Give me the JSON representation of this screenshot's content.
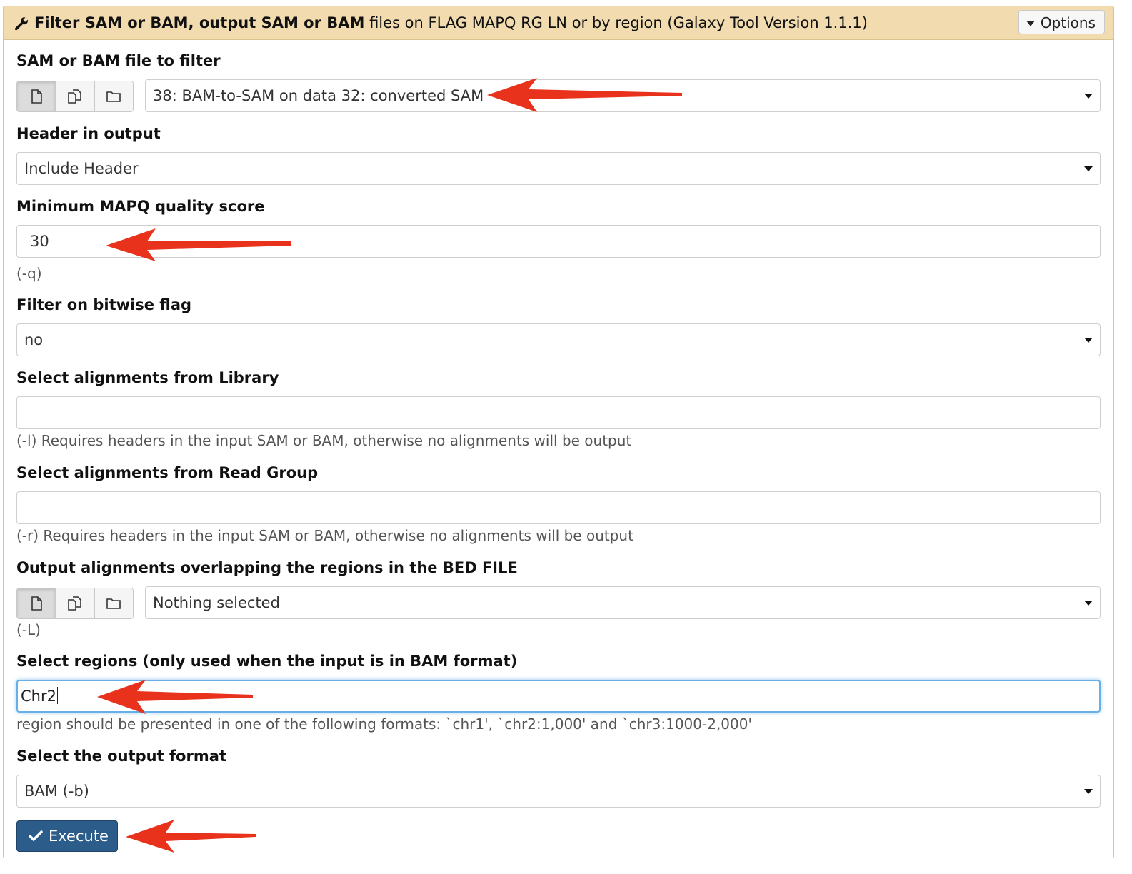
{
  "header": {
    "title_bold": "Filter SAM or BAM, output SAM or BAM",
    "title_rest": " files on FLAG MAPQ RG LN or by region (Galaxy Tool Version 1.1.1)",
    "options_label": "Options"
  },
  "fields": {
    "input_file": {
      "label": "SAM or BAM file to filter",
      "value": "38: BAM-to-SAM on data 32: converted SAM"
    },
    "header_output": {
      "label": "Header in output",
      "value": "Include Header"
    },
    "mapq": {
      "label": "Minimum MAPQ quality score",
      "value": "30",
      "help": "(-q)"
    },
    "bitwise_flag": {
      "label": "Filter on bitwise flag",
      "value": "no"
    },
    "library": {
      "label": "Select alignments from Library",
      "value": "",
      "help": "(-l) Requires headers in the input SAM or BAM, otherwise no alignments will be output"
    },
    "read_group": {
      "label": "Select alignments from Read Group",
      "value": "",
      "help": "(-r) Requires headers in the input SAM or BAM, otherwise no alignments will be output"
    },
    "bed_file": {
      "label": "Output alignments overlapping the regions in the BED FILE",
      "value": "Nothing selected",
      "help": "(-L)"
    },
    "regions": {
      "label": "Select regions (only used when the input is in BAM format)",
      "value": "Chr2",
      "help": "region should be presented in one of the following formats: `chr1', `chr2:1,000' and `chr3:1000-2,000'"
    },
    "output_format": {
      "label": "Select the output format",
      "value": "BAM (-b)"
    }
  },
  "execute_label": "Execute",
  "icons": [
    "wrench-icon",
    "caret-down-icon",
    "file-icon",
    "files-icon",
    "folder-icon",
    "check-icon",
    "red-arrow-annotation"
  ],
  "colors": {
    "header_bg": "#f2dcaf",
    "execute_bg": "#2c5d8a",
    "arrow": "#e8321c",
    "focus": "#66afe9"
  }
}
